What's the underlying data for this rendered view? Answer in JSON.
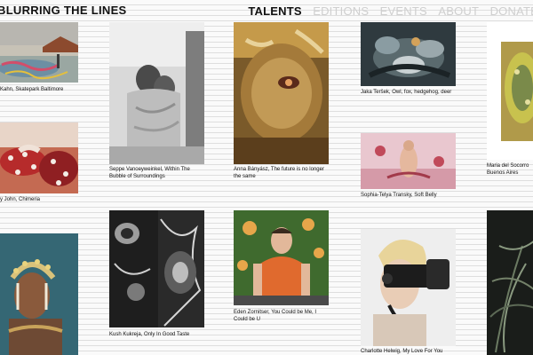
{
  "site": {
    "title": "BLURRING THE LINES"
  },
  "nav": {
    "items": [
      {
        "label": "TALENTS",
        "active": true
      },
      {
        "label": "EDITIONS",
        "active": false
      },
      {
        "label": "EVENTS",
        "active": false
      },
      {
        "label": "ABOUT",
        "active": false
      },
      {
        "label": "DONATE",
        "active": false
      }
    ]
  },
  "artworks": [
    {
      "caption": "Kahn, Skatepark Baltimore"
    },
    {
      "caption": "y John, Chimeria"
    },
    {
      "caption": ""
    },
    {
      "caption": "Seppe Vanoeyweinkel, Within The Bubble of Surroundings"
    },
    {
      "caption": "Kush Kukreja, Only In Good Taste"
    },
    {
      "caption": "Anna Bányász, The future is no longer the same"
    },
    {
      "caption": "Eden Zornitser, You Could be Me, I Could be U"
    },
    {
      "caption": "Jaka Teršek, Owl, fox, hedgehog, deer"
    },
    {
      "caption": "Sophia-Telya Transky, Soft Belly"
    },
    {
      "caption": "Charlotte Helwig, My Love For You"
    },
    {
      "caption": "Maria del Socorro Buenos Aires"
    },
    {
      "caption": ""
    }
  ],
  "colors": {
    "active_nav": "#111111",
    "inactive_nav": "#cfcfcf",
    "stripe_light": "#fafafa",
    "stripe_dark": "#dedede"
  }
}
